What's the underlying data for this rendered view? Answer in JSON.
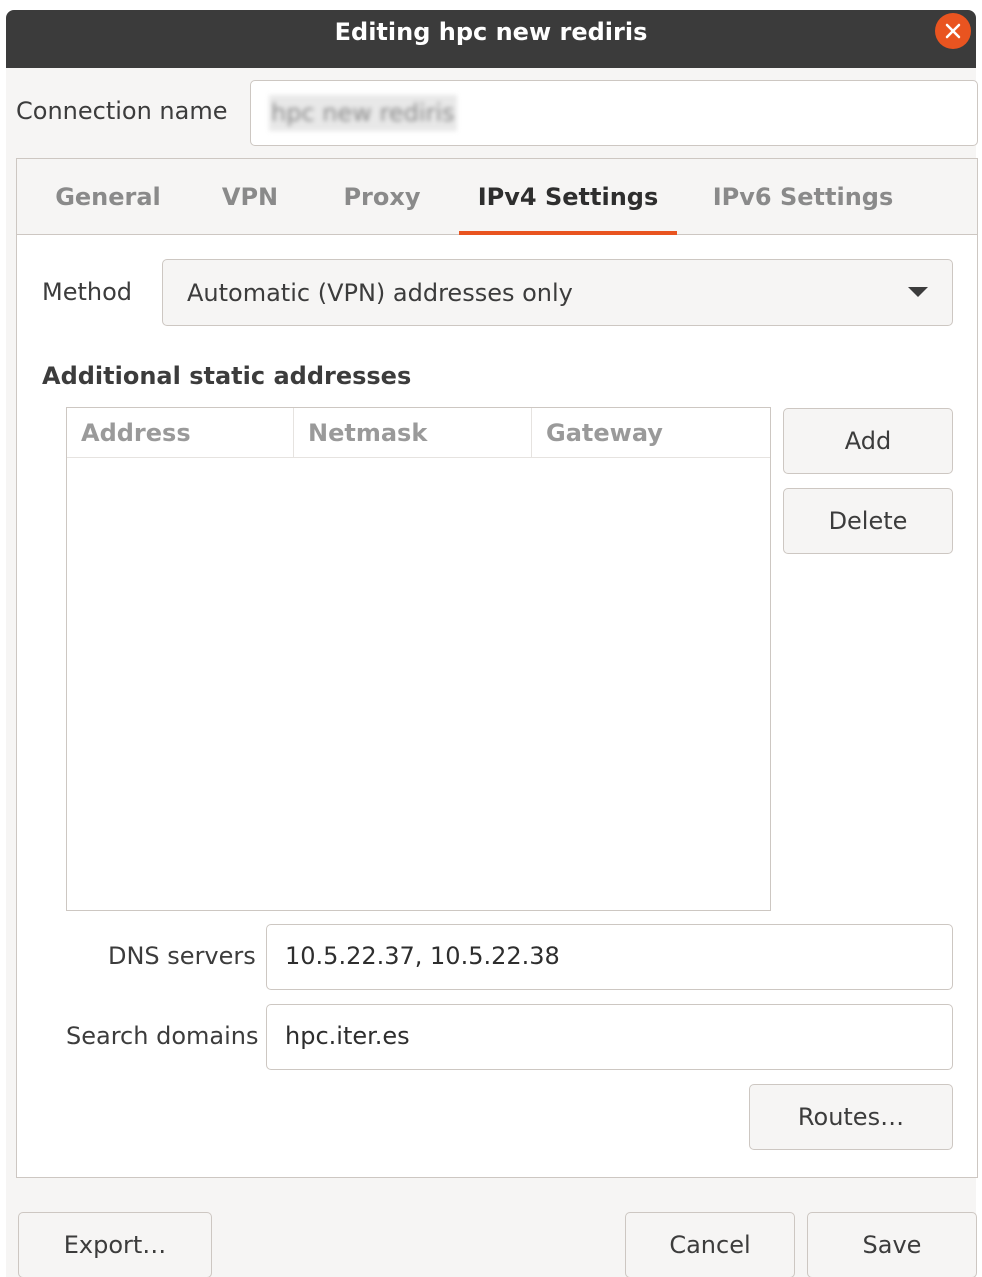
{
  "window": {
    "title": "Editing hpc new rediris"
  },
  "connection_name": {
    "label": "Connection name",
    "value": "hpc new rediris"
  },
  "tabs": [
    {
      "label": "General",
      "active": false
    },
    {
      "label": "VPN",
      "active": false
    },
    {
      "label": "Proxy",
      "active": false
    },
    {
      "label": "IPv4 Settings",
      "active": true
    },
    {
      "label": "IPv6 Settings",
      "active": false
    }
  ],
  "ipv4": {
    "method_label": "Method",
    "method_value": "Automatic (VPN) addresses only",
    "addresses_heading": "Additional static addresses",
    "columns": [
      "Address",
      "Netmask",
      "Gateway"
    ],
    "rows": [],
    "add_label": "Add",
    "delete_label": "Delete",
    "dns_label": "DNS servers",
    "dns_value": "10.5.22.37, 10.5.22.38",
    "search_label": "Search domains",
    "search_value": "hpc.iter.es",
    "routes_label": "Routes…"
  },
  "footer": {
    "export_label": "Export…",
    "cancel_label": "Cancel",
    "save_label": "Save"
  },
  "colors": {
    "accent": "#e95420",
    "titlebar": "#3b3b3b"
  }
}
